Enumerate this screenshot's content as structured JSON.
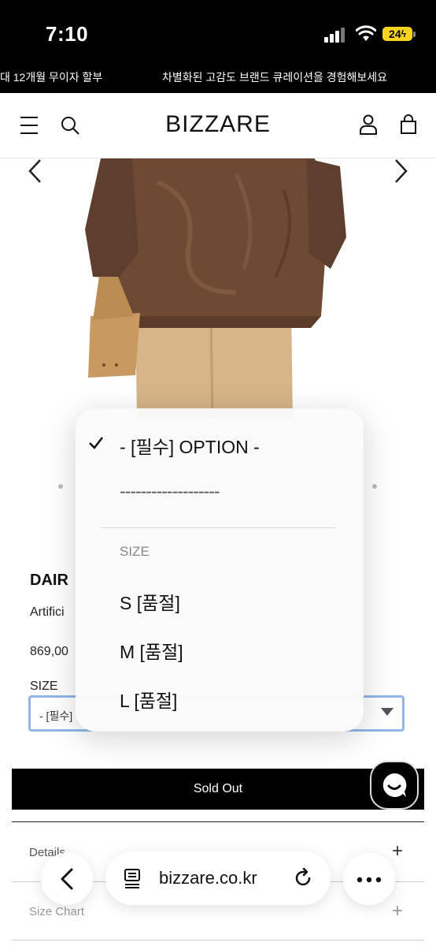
{
  "status_bar": {
    "time": "7:10",
    "battery": "24",
    "icons": [
      "cellular-signal-icon",
      "wifi-icon",
      "battery-icon"
    ]
  },
  "marquee": {
    "left_text": "대 12개월 무이자 할부",
    "right_text": "차별화된 고감도 브랜드 큐레이션을 경험해보세요"
  },
  "header": {
    "logo": "BIZZARE",
    "icons": [
      "menu-icon",
      "search-icon",
      "account-icon",
      "cart-icon"
    ]
  },
  "product": {
    "name": "DAIR",
    "subtitle": "Artifici",
    "price": "869,00",
    "size_label": "SIZE",
    "select_value": "- [필수]",
    "sold_out_label": "Sold Out"
  },
  "accordion": {
    "details_label": "Details",
    "size_chart_label": "Size Chart"
  },
  "dropdown": {
    "selected_option": "- [필수] OPTION -",
    "divider_option": "-------------------",
    "group_label": "SIZE",
    "options": [
      "S [품절]",
      "M [품절]",
      "L [품절]"
    ]
  },
  "browser": {
    "url": "bizzare.co.kr",
    "icons": [
      "back-icon",
      "reader-icon",
      "reload-icon",
      "more-icon"
    ]
  },
  "colors": {
    "accent_select_border": "#8fb8e8",
    "sold_out_bg": "#000000",
    "battery": "#f5d320"
  }
}
